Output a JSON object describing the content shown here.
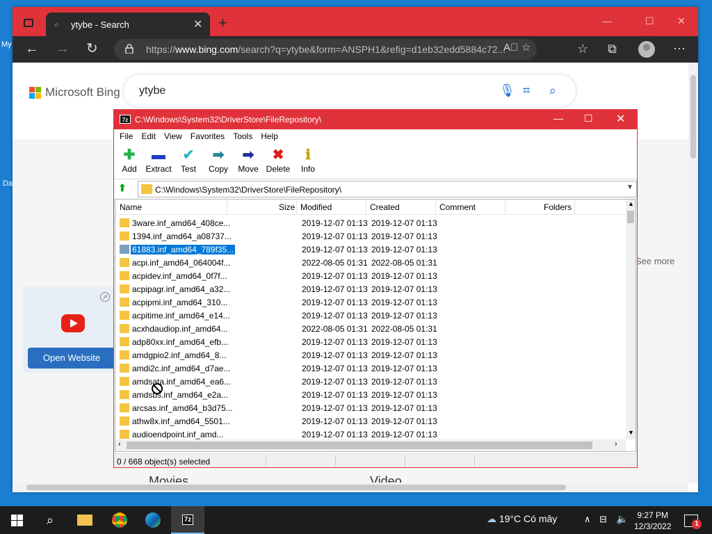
{
  "desktop": {
    "frag1": "My",
    "frag2": "Da"
  },
  "browser": {
    "tab_title": "ytybe - Search",
    "tab_close": "✕",
    "new_tab": "+",
    "url_prefix": "https://",
    "url_domain": "www.bing.com",
    "url_rest": "/search?q=ytybe&form=ANSPH1&refig=d1eb32edd5884c72..."
  },
  "bing": {
    "brand": "Microsoft Bing",
    "query": "ytybe",
    "see_more": "See more",
    "open_website": "Open Website",
    "movies": "Movies",
    "video": "Video"
  },
  "sevenzip": {
    "title": "C:\\Windows\\System32\\DriverStore\\FileRepository\\",
    "menu": [
      "File",
      "Edit",
      "View",
      "Favorites",
      "Tools",
      "Help"
    ],
    "toolbar": [
      {
        "label": "Add",
        "icon": "plus-icon",
        "glyph": "✚",
        "color": "#22b14c"
      },
      {
        "label": "Extract",
        "icon": "minus-icon",
        "glyph": "▬",
        "color": "#1f3fbf"
      },
      {
        "label": "Test",
        "icon": "check-icon",
        "glyph": "✔",
        "color": "#2bb7c9"
      },
      {
        "label": "Copy",
        "icon": "double-arrow-icon",
        "glyph": "➡",
        "color": "#23889a"
      },
      {
        "label": "Move",
        "icon": "arrow-right-icon",
        "glyph": "➡",
        "color": "#1f2f9f"
      },
      {
        "label": "Delete",
        "icon": "delete-x-icon",
        "glyph": "✖",
        "color": "#e01b1b"
      },
      {
        "label": "Info",
        "icon": "info-icon",
        "glyph": "ℹ",
        "color": "#c9a400"
      }
    ],
    "path": "C:\\Windows\\System32\\DriverStore\\FileRepository\\",
    "columns": [
      "Name",
      "Size",
      "Modified",
      "Created",
      "Comment",
      "Folders"
    ],
    "rows": [
      {
        "name": "3ware.inf_amd64_408ce...",
        "modified": "2019-12-07 01:13",
        "created": "2019-12-07 01:13"
      },
      {
        "name": "1394.inf_amd64_a08737...",
        "modified": "2019-12-07 01:13",
        "created": "2019-12-07 01:13"
      },
      {
        "name": "61883.inf_amd64_789f35...",
        "modified": "2019-12-07 01:13",
        "created": "2019-12-07 01:13",
        "selected": true
      },
      {
        "name": "acpi.inf_amd64_064004f...",
        "modified": "2022-08-05 01:31",
        "created": "2022-08-05 01:31"
      },
      {
        "name": "acpidev.inf_amd64_0f7f...",
        "modified": "2019-12-07 01:13",
        "created": "2019-12-07 01:13"
      },
      {
        "name": "acpipagr.inf_amd64_a32...",
        "modified": "2019-12-07 01:13",
        "created": "2019-12-07 01:13"
      },
      {
        "name": "acpipmi.inf_amd64_310...",
        "modified": "2019-12-07 01:13",
        "created": "2019-12-07 01:13"
      },
      {
        "name": "acpitime.inf_amd64_e14...",
        "modified": "2019-12-07 01:13",
        "created": "2019-12-07 01:13"
      },
      {
        "name": "acxhdaudiop.inf_amd64...",
        "modified": "2022-08-05 01:31",
        "created": "2022-08-05 01:31"
      },
      {
        "name": "adp80xx.inf_amd64_efb...",
        "modified": "2019-12-07 01:13",
        "created": "2019-12-07 01:13"
      },
      {
        "name": "amdgpio2.inf_amd64_8...",
        "modified": "2019-12-07 01:13",
        "created": "2019-12-07 01:13"
      },
      {
        "name": "amdi2c.inf_amd64_d7ae...",
        "modified": "2019-12-07 01:13",
        "created": "2019-12-07 01:13"
      },
      {
        "name": "amdsata.inf_amd64_ea6...",
        "modified": "2019-12-07 01:13",
        "created": "2019-12-07 01:13"
      },
      {
        "name": "amdsbs.inf_amd64_e2a...",
        "modified": "2019-12-07 01:13",
        "created": "2019-12-07 01:13"
      },
      {
        "name": "arcsas.inf_amd64_b3d75...",
        "modified": "2019-12-07 01:13",
        "created": "2019-12-07 01:13"
      },
      {
        "name": "athw8x.inf_amd64_5501...",
        "modified": "2019-12-07 01:13",
        "created": "2019-12-07 01:13"
      },
      {
        "name": "audioendpoint.inf_amd...",
        "modified": "2019-12-07 01:13",
        "created": "2019-12-07 01:13"
      }
    ],
    "status": "0 / 668 object(s) selected"
  },
  "taskbar": {
    "app_7z": "7z",
    "weather": "19°C  Có mây",
    "time": "9:27 PM",
    "date": "12/3/2022",
    "notification_count": "1"
  }
}
